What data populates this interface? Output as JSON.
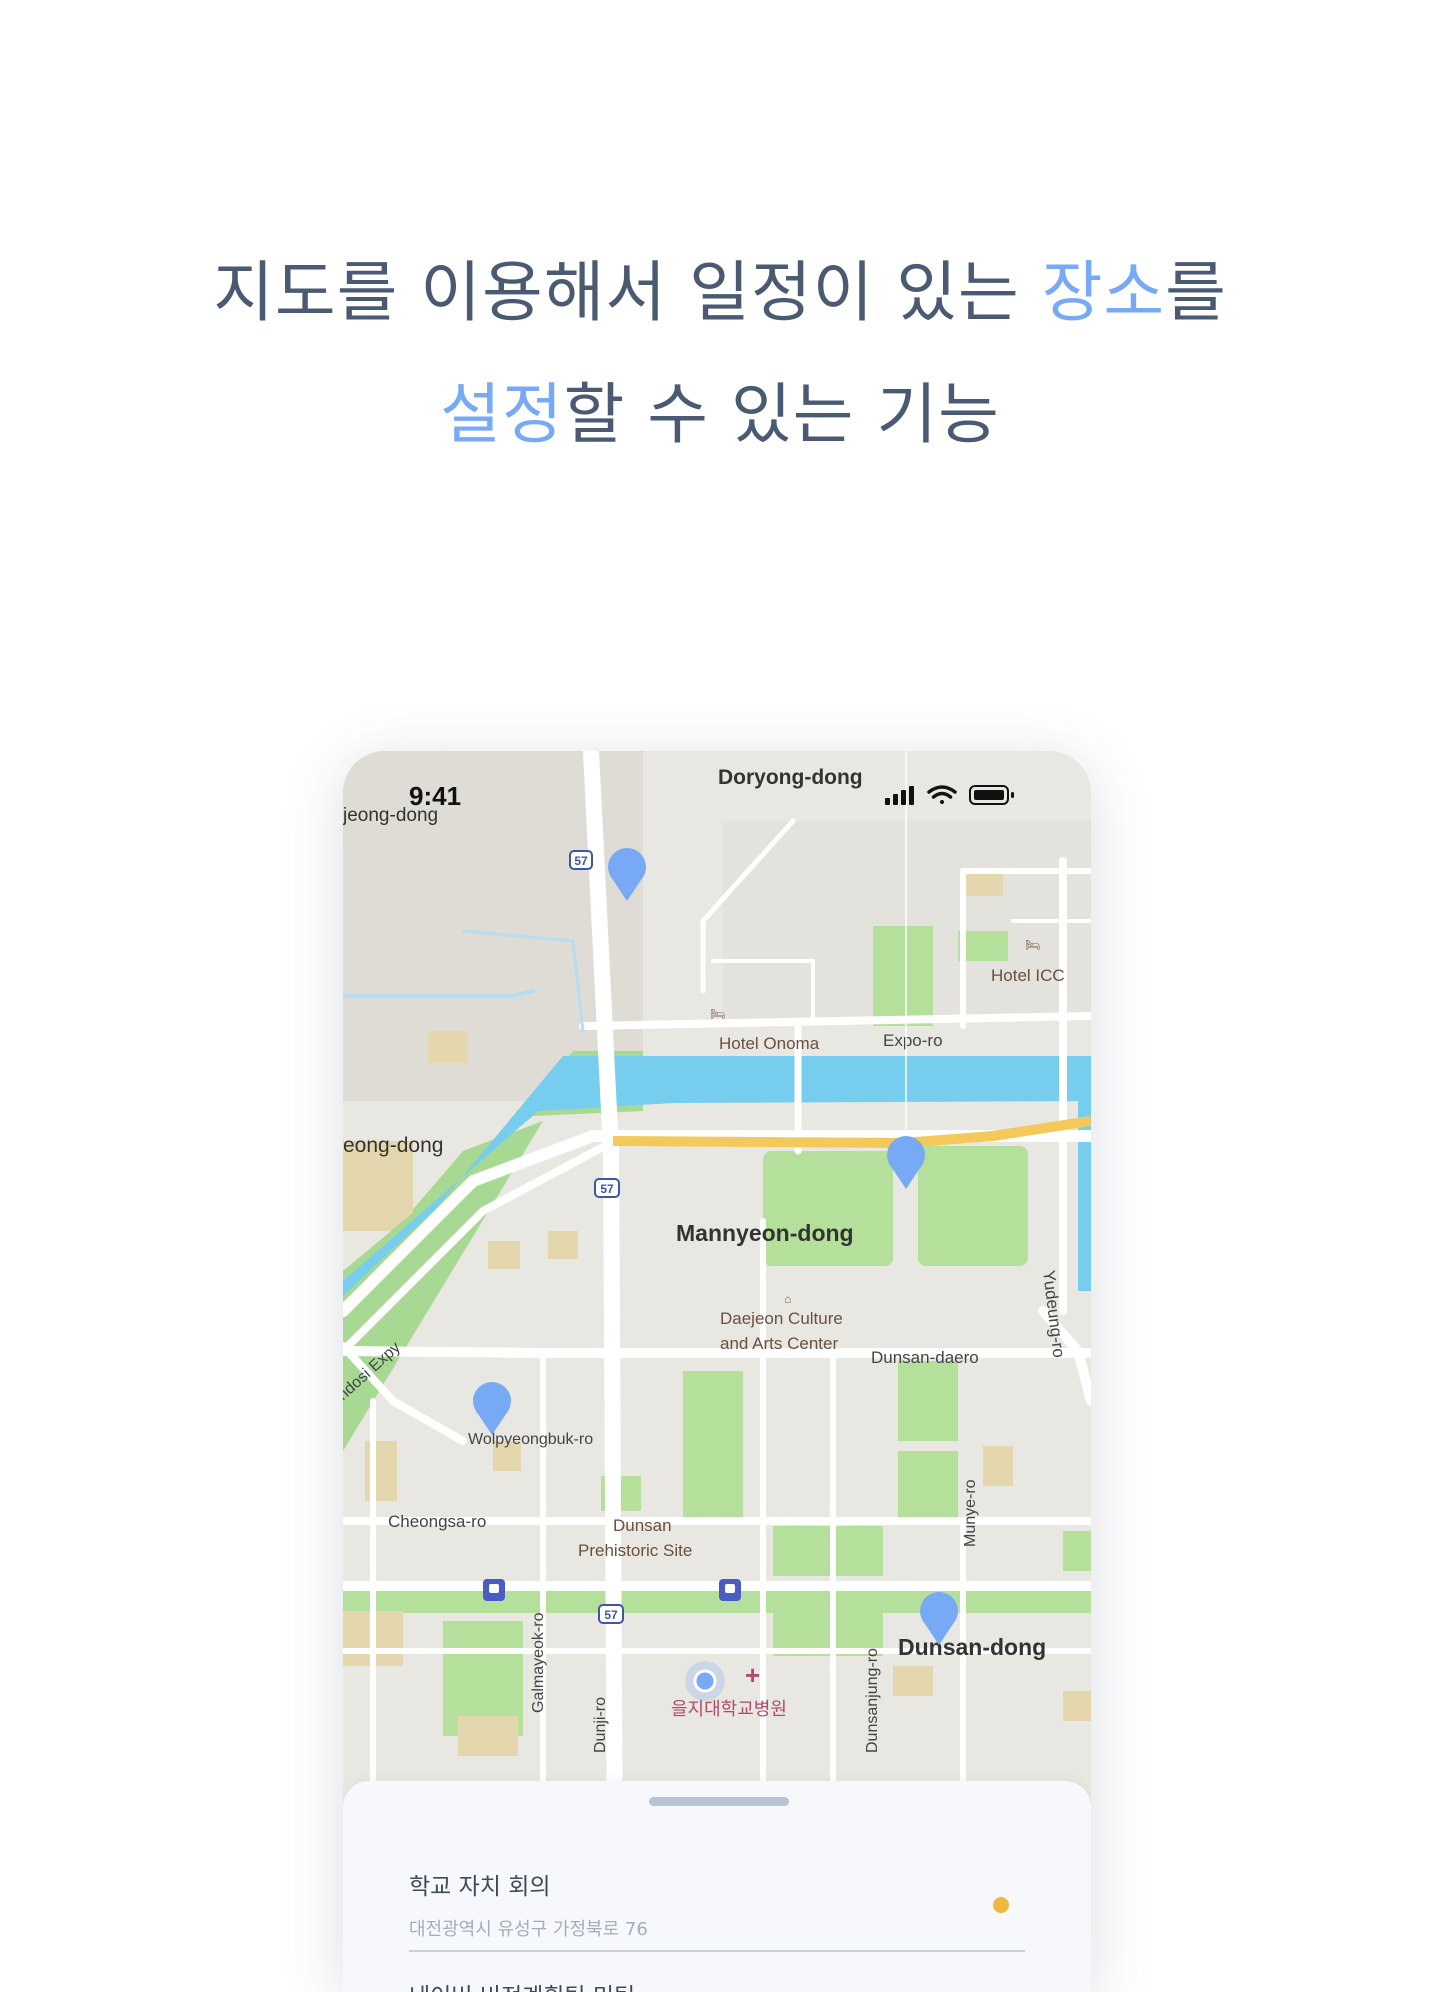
{
  "headline": {
    "line1_a": "지도를 이용해서 일정이 있는 ",
    "line1_highlight": "장소",
    "line1_b": "를",
    "line2_highlight": "설정",
    "line2_b": "할 수 있는 기능"
  },
  "status_bar": {
    "time": "9:41"
  },
  "map": {
    "labels": {
      "doryong": "Doryong-dong",
      "jeong_top": "jeong-dong",
      "hotel_icc": "Hotel ICC",
      "hotel_onoma": "Hotel Onoma",
      "expo_ro": "Expo-ro",
      "jeong_left": "eong-dong",
      "mannyeon": "Mannyeon-dong",
      "culture_1": "Daejeon Culture",
      "culture_2": "and Arts Center",
      "dunsan_daero": "Dunsan-daero",
      "yudeung": "Yudeung-ro",
      "expy": "ndosi Expy",
      "wolpyeong": "Wolpyeongbuk-ro",
      "cheongsa": "Cheongsa-ro",
      "prehistoric_1": "Dunsan",
      "prehistoric_2": "Prehistoric Site",
      "munye": "Munye-ro",
      "galmayeok": "Galmayeok-ro",
      "dunji": "Dunji-ro",
      "hospital": "을지대학교병원",
      "dunsanjung": "Dunsanjung-ro",
      "dunsan_dong": "Dunsan-dong",
      "route_57": "57"
    },
    "colors": {
      "land": "#e9e7e2",
      "park": "#b5e09b",
      "river": "#76cdee",
      "road": "#ffffff",
      "highway": "#f2c95a",
      "pin": "#78a9f5"
    }
  },
  "schedule": [
    {
      "title": "학교 자치 회의",
      "address": "대전광역시 유성구 가정북로 76",
      "dot_color": "#f0b93e"
    },
    {
      "title": "네이버 비전계획팀 미팅"
    }
  ]
}
